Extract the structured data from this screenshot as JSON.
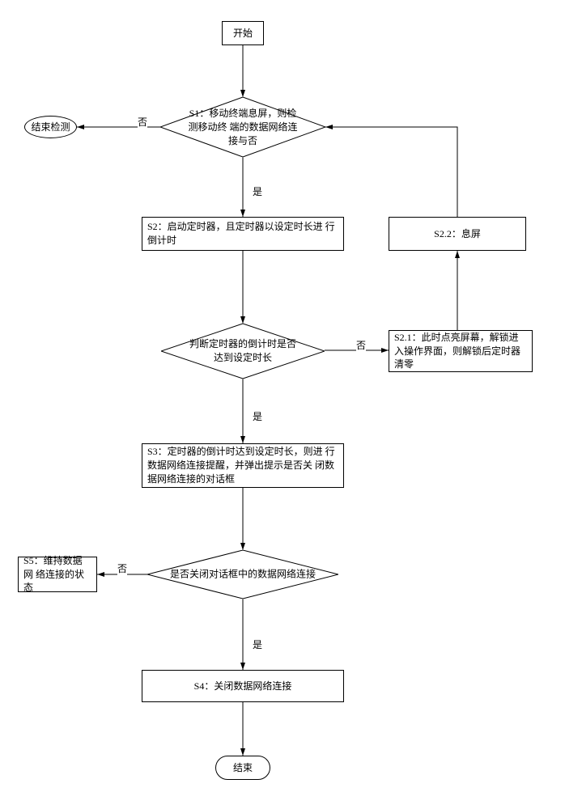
{
  "chart_data": {
    "type": "flowchart",
    "nodes": [
      {
        "id": "start",
        "type": "terminator",
        "text": "开始"
      },
      {
        "id": "s1",
        "type": "decision",
        "text": "S1：移动终端息屏，则检测移动终端的数据网络连接与否"
      },
      {
        "id": "end_detect",
        "type": "terminator",
        "text": "结束检测"
      },
      {
        "id": "s2",
        "type": "process",
        "text": "S2：启动定时器，且定时器以设定时长进行倒计时"
      },
      {
        "id": "s22",
        "type": "process",
        "text": "S2.2：息屏"
      },
      {
        "id": "judge",
        "type": "decision",
        "text": "判断定时器的倒计时是否达到设定时长"
      },
      {
        "id": "s21",
        "type": "process",
        "text": "S2.1：此时点亮屏幕，解锁进入操作界面，则解锁后定时器清零"
      },
      {
        "id": "s3",
        "type": "process",
        "text": "S3：定时器的倒计时达到设定时长，则进行数据网络连接提醒，并弹出提示是否关闭数据网络连接的对话框"
      },
      {
        "id": "close_q",
        "type": "decision",
        "text": "是否关闭对话框中的数据网络连接"
      },
      {
        "id": "s5",
        "type": "process",
        "text": "S5：维持数据网络连接的状态"
      },
      {
        "id": "s4",
        "type": "process",
        "text": "S4：关闭数据网络连接"
      },
      {
        "id": "end",
        "type": "terminator",
        "text": "结束"
      }
    ],
    "edges": [
      {
        "from": "start",
        "to": "s1"
      },
      {
        "from": "s1",
        "to": "end_detect",
        "label": "否"
      },
      {
        "from": "s1",
        "to": "s2",
        "label": "是"
      },
      {
        "from": "s2",
        "to": "judge"
      },
      {
        "from": "judge",
        "to": "s21",
        "label": "否"
      },
      {
        "from": "s21",
        "to": "s22"
      },
      {
        "from": "s22",
        "to": "s1"
      },
      {
        "from": "judge",
        "to": "s3",
        "label": "是"
      },
      {
        "from": "s3",
        "to": "close_q"
      },
      {
        "from": "close_q",
        "to": "s5",
        "label": "否"
      },
      {
        "from": "close_q",
        "to": "s4",
        "label": "是"
      },
      {
        "from": "s4",
        "to": "end"
      }
    ]
  },
  "labels": {
    "yes": "是",
    "no": "否"
  },
  "nodes": {
    "start": "开始",
    "s1": "S1：移动终端息屏，则检测移动终\n端的数据网络连接与否",
    "end_detect": "结束检测",
    "s2": "S2：启动定时器，且定时器以设定时长进\n行倒计时",
    "s22": "S2.2：息屏",
    "judge": "判断定时器的倒计时是否\n达到设定时长",
    "s21": "S2.1：此时点亮屏幕，解锁进\n入操作界面，则解锁后定时器\n清零",
    "s3": "S3：定时器的倒计时达到设定时长，则进\n行数据网络连接提醒，并弹出提示是否关\n闭数据网络连接的对话框",
    "close_q": "是否关闭对话框中的数据网络连接",
    "s5": "S5：维持数据网\n络连接的状态",
    "s4": "S4：关闭数据网络连接",
    "end": "结束"
  }
}
